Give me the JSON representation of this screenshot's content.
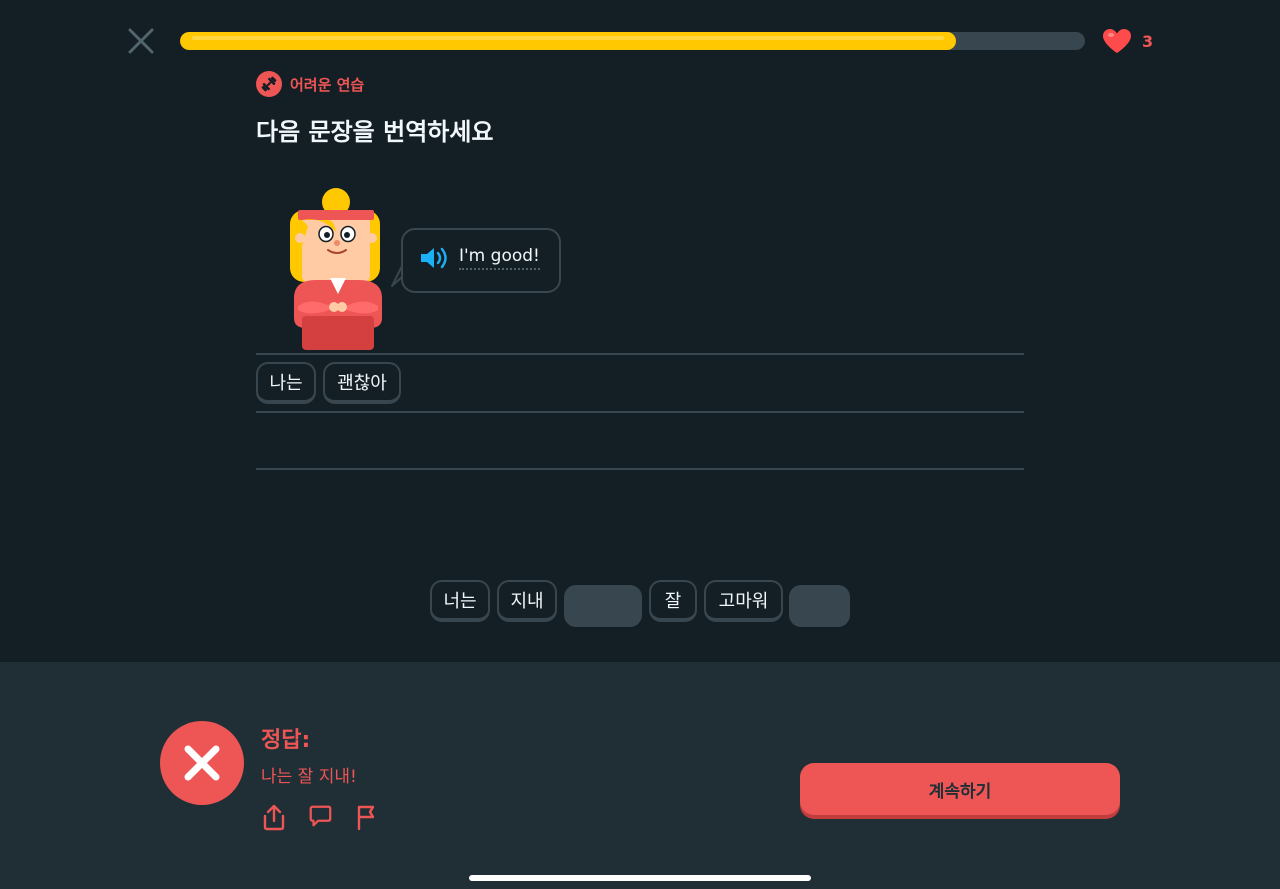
{
  "header": {
    "progress": 0.857,
    "hearts": "3"
  },
  "badge": {
    "label": "어려운 연습"
  },
  "prompt": {
    "title": "다음 문장을 번역하세요"
  },
  "speech": {
    "text": "I'm good!"
  },
  "answer_area": {
    "selected": [
      "나는",
      "괜찮아"
    ]
  },
  "word_bank": {
    "items": [
      {
        "label": "너는",
        "used": false
      },
      {
        "label": "지내",
        "used": false
      },
      {
        "label": "",
        "used": true
      },
      {
        "label": "잘",
        "used": false
      },
      {
        "label": "고마워",
        "used": false
      },
      {
        "label": "",
        "used": true
      }
    ]
  },
  "footer": {
    "heading": "정답:",
    "correct_answer": "나는 잘 지내!",
    "continue_label": "계속하기"
  },
  "colors": {
    "background": "#131f24",
    "footer_bg": "#202f36",
    "accent_red": "#ee5555",
    "progress_yellow": "#ffc800",
    "border": "#37464f"
  },
  "icons": {
    "close": "close-icon",
    "heart": "heart-icon",
    "badge": "dumbbell-icon",
    "speaker": "speaker-icon",
    "result": "x-mark-icon",
    "share": "share-icon",
    "comment": "comment-icon",
    "report": "flag-icon"
  }
}
